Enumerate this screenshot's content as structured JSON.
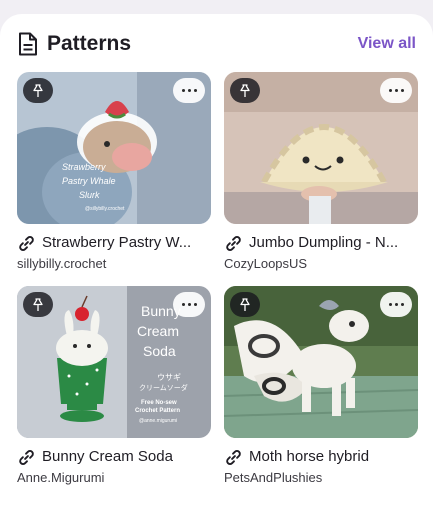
{
  "section": {
    "title": "Patterns",
    "view_all": "View all"
  },
  "patterns": [
    {
      "name": "Strawberry Pastry W...",
      "author": "sillybilly.crochet",
      "image_text": [
        "Strawberry",
        "Pastry Whale",
        "Slurk",
        "@sillybilly.crochet"
      ]
    },
    {
      "name": "Jumbo Dumpling - N...",
      "author": "CozyLoopsUS",
      "image_text": []
    },
    {
      "name": "Bunny Cream Soda",
      "author": "Anne.Migurumi",
      "image_text": [
        "Bunny",
        "Cream",
        "Soda",
        "ウサギ",
        "クリームソーダ",
        "Free No-sew",
        "Crochet Pattern",
        "@anne.migurumi"
      ]
    },
    {
      "name": "Moth horse hybrid",
      "author": "PetsAndPlushies",
      "image_text": []
    }
  ],
  "colors": {
    "accent": "#7b55c7",
    "text": "#1f1d24",
    "pin_button_bg": "#19191e",
    "more_button_bg": "#ffffff"
  },
  "icons": {
    "header": "document-icon",
    "pin": "pushpin-icon",
    "more": "more-horizontal-icon",
    "link": "link-icon"
  }
}
